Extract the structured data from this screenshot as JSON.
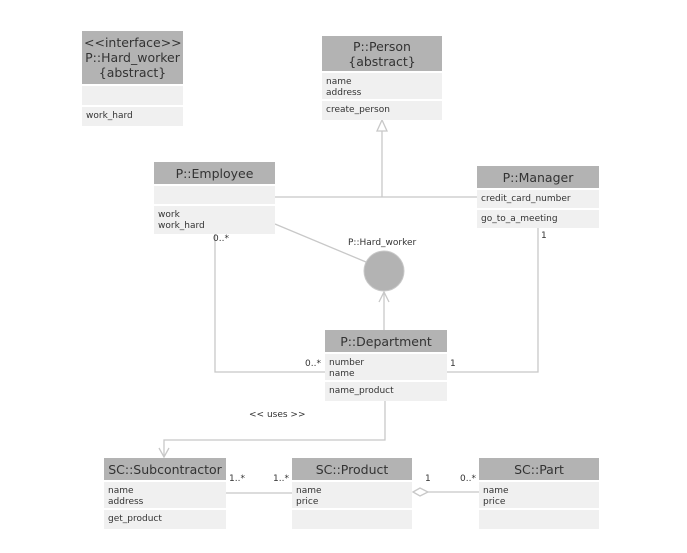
{
  "diagram": {
    "classes": {
      "hard_worker": {
        "stereotype": "<<interface>>",
        "name": "P::Hard_worker",
        "modifier": "{abstract}",
        "attributes": [],
        "operations": [
          "work_hard"
        ]
      },
      "person": {
        "name": "P::Person",
        "modifier": "{abstract}",
        "attributes": [
          "name",
          "address"
        ],
        "operations": [
          "create_person"
        ]
      },
      "employee": {
        "name": "P::Employee",
        "attributes": [],
        "operations": [
          "work",
          "work_hard"
        ]
      },
      "manager": {
        "name": "P::Manager",
        "attributes": [
          "credit_card_number"
        ],
        "operations": [
          "go_to_a_meeting"
        ]
      },
      "department": {
        "name": "P::Department",
        "attributes": [
          "number",
          "name"
        ],
        "operations": [
          "name_product"
        ]
      },
      "subcontractor": {
        "name": "SC::Subcontractor",
        "attributes": [
          "name",
          "address"
        ],
        "operations": [
          "get_product"
        ]
      },
      "product": {
        "name": "SC::Product",
        "attributes": [
          "name",
          "price"
        ],
        "operations": []
      },
      "part": {
        "name": "SC::Part",
        "attributes": [
          "name",
          "price"
        ],
        "operations": []
      }
    },
    "interface_lollipop_label": "P::Hard_worker",
    "labels": {
      "employee_dept_employee_end": "0..*",
      "employee_dept_dept_end": "0..*",
      "manager_dept_manager_end": "1",
      "manager_dept_dept_end": "1",
      "uses": "<< uses >>",
      "sub_product_sub_end": "1..*",
      "sub_product_product_end": "1..*",
      "product_part_product_end": "1",
      "product_part_part_end": "0..*"
    },
    "colors": {
      "header": "#b3b3b3",
      "section": "#f0f0f0",
      "line": "#c8c8c8",
      "lollipop": "#b3b3b3",
      "text": "#333333"
    }
  }
}
